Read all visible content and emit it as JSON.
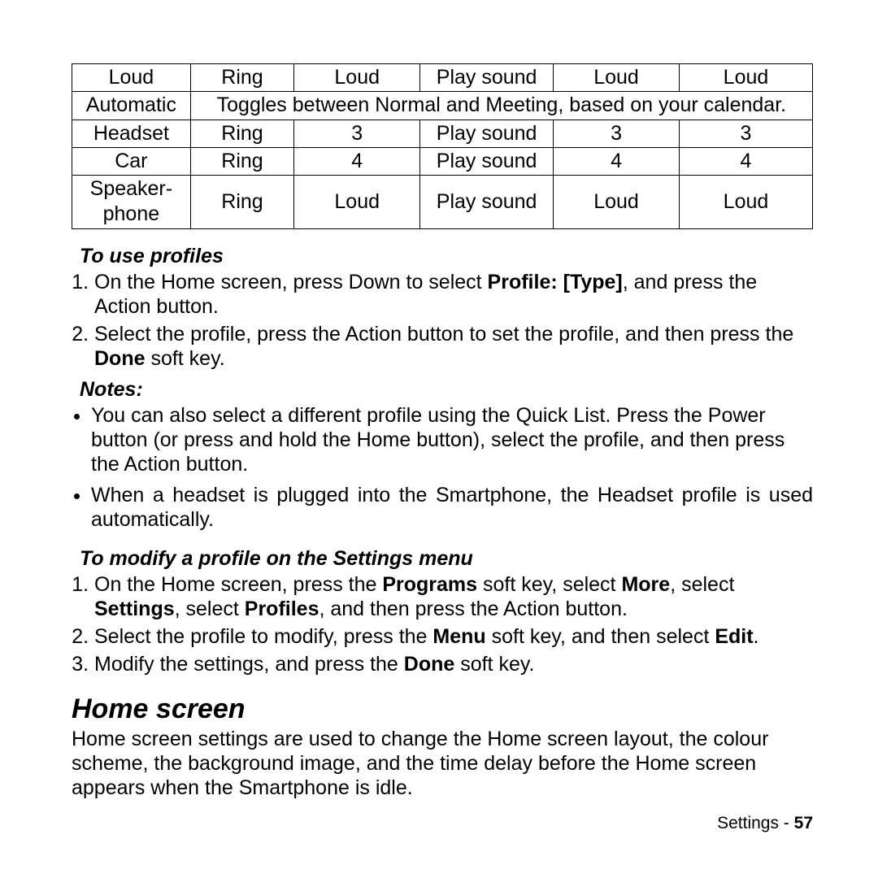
{
  "table": {
    "rows": [
      {
        "c1": "Loud",
        "c2": "Ring",
        "c3": "Loud",
        "c4": "Play sound",
        "c5": "Loud",
        "c6": "Loud"
      },
      {
        "c1": "Automatic",
        "span": "Toggles between Normal and Meeting, based on your calendar."
      },
      {
        "c1": "Headset",
        "c2": "Ring",
        "c3": "3",
        "c4": "Play sound",
        "c5": "3",
        "c6": "3"
      },
      {
        "c1": "Car",
        "c2": "Ring",
        "c3": "4",
        "c4": "Play sound",
        "c5": "4",
        "c6": "4"
      },
      {
        "c1": "Speaker-\nphone",
        "c2": "Ring",
        "c3": "Loud",
        "c4": "Play sound",
        "c5": "Loud",
        "c6": "Loud"
      }
    ]
  },
  "useProfiles": {
    "heading": "To use profiles",
    "step1_a": "On the Home screen, press Down to select ",
    "step1_b": "Profile: [Type]",
    "step1_c": ", and press the Action button.",
    "step2_a": "Select the profile, press the Action button to set the profile, and then press the ",
    "step2_b": "Done",
    "step2_c": " soft key."
  },
  "notes": {
    "heading": "Notes:",
    "n1": "You can also select a different profile using the Quick List. Press the Power button (or press and hold the Home button), select the profile, and then press the Action button.",
    "n2": " When a headset is plugged into the Smartphone, the Headset profile is used automatically."
  },
  "modifyProfile": {
    "heading": "To modify a profile on the Settings menu",
    "s1_a": "On the Home screen, press the ",
    "s1_b": "Programs",
    "s1_c": " soft key, select ",
    "s1_d": "More",
    "s1_e": ", select ",
    "s1_f": "Settings",
    "s1_g": ", select ",
    "s1_h": "Profiles",
    "s1_i": ", and then press the Action button.",
    "s2_a": "Select the profile to modify, press the ",
    "s2_b": "Menu",
    "s2_c": " soft key, and then select ",
    "s2_d": "Edit",
    "s2_e": ".",
    "s3_a": "Modify the settings, and press the ",
    "s3_b": "Done",
    "s3_c": " soft key."
  },
  "homeScreen": {
    "heading": "Home screen",
    "body": "Home screen settings are used to change the Home screen layout, the colour scheme, the background image, and the time delay before the Home screen appears when the Smartphone is idle."
  },
  "footer": {
    "section": "Settings - ",
    "page": "57"
  }
}
